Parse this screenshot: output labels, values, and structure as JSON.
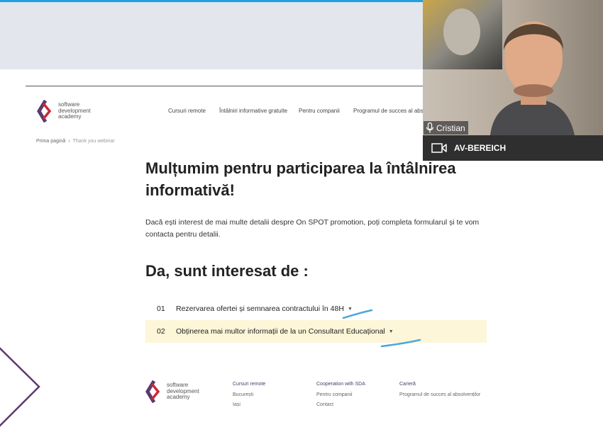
{
  "site": {
    "logo_lines": [
      "software",
      "development",
      "academy"
    ],
    "nav": [
      "Cursuri remote",
      "Întâlniri informative gratuite",
      "Pentru companii",
      "Programul de succes al absolv"
    ],
    "breadcrumb": {
      "home": "Prima pagină",
      "current": "Thank you webinar"
    }
  },
  "main": {
    "heading_line1": "Mulțumim pentru participarea la întâlnirea",
    "heading_line2": "informativă!",
    "intro_line1": "Dacă ești interest de mai multe detalii despre On SPOT promotion, poți completa formularul și te vom",
    "intro_line2": "contacta pentru detalii.",
    "subheading": "Da, sunt interesat de :",
    "options": [
      {
        "num": "01",
        "label": "Rezervarea ofertei și semnarea contractului în 48H"
      },
      {
        "num": "02",
        "label": "Obținerea mai multor informații de la un Consultant Educațional"
      }
    ]
  },
  "footer": {
    "logo_lines": [
      "software",
      "development",
      "academy"
    ],
    "columns": [
      {
        "heading": "Cursuri remote",
        "items": [
          "București",
          "Iași"
        ]
      },
      {
        "heading": "Cooperation with SDA",
        "items": [
          "Pentru companii",
          "Contact"
        ]
      },
      {
        "heading": "Carieră",
        "items": [
          "Programul de succes al absolvenților"
        ]
      }
    ]
  },
  "video_call": {
    "participant_name": "Cristian",
    "room_name": "AV-BEREICH"
  },
  "colors": {
    "accent": "#1fa1e0",
    "brand_purple": "#5b3a6e",
    "brand_red": "#c62a3b",
    "highlight": "#fdf6d8",
    "annotation": "#4ea6dc"
  },
  "icons": {
    "microphone": "microphone-icon",
    "camera": "video-camera-icon"
  }
}
